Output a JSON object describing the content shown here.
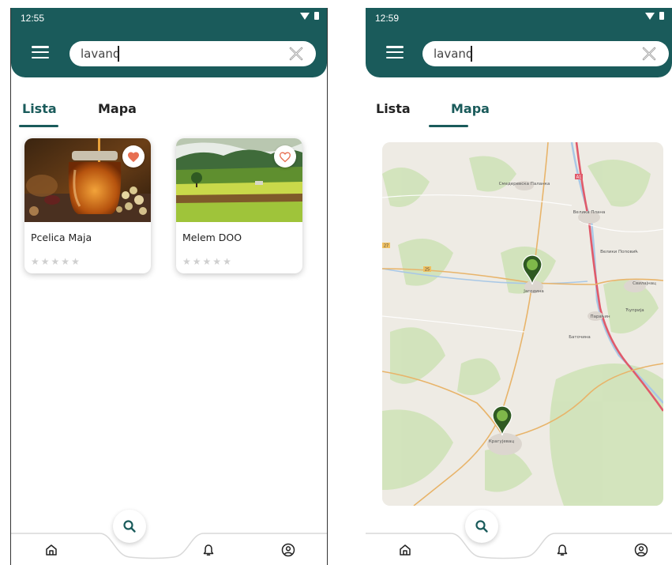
{
  "screens": [
    {
      "time": "12:55",
      "search": {
        "value": "lavand"
      },
      "tabs": [
        {
          "label": "Lista",
          "active": true
        },
        {
          "label": "Mapa",
          "active": false
        }
      ],
      "cards": [
        {
          "title": "Pcelica Maja",
          "favorite": true,
          "rating": 0
        },
        {
          "title": "Melem DOO",
          "favorite": false,
          "rating": 0
        }
      ]
    },
    {
      "time": "12:59",
      "search": {
        "value": "lavand"
      },
      "tabs": [
        {
          "label": "Lista",
          "active": false
        },
        {
          "label": "Mapa",
          "active": true
        }
      ],
      "map": {
        "labels": [
          "Свилајнац",
          "Велики Поповић",
          "Ћуприја",
          "Параћин",
          "Јагодина",
          "Крагујевац",
          "Баточина",
          "Смедеревска Паланка",
          "Велика Плана"
        ],
        "road_labels": [
          "A1",
          "27",
          "25"
        ],
        "markers": [
          {
            "place": "Јагодина"
          },
          {
            "place": "Крагујевац"
          }
        ]
      }
    }
  ],
  "bottom_nav": [
    "home-icon",
    "search-icon",
    "bell-icon",
    "profile-icon"
  ],
  "colors": {
    "primary": "#1a5b5b",
    "heart": "#e76f51",
    "star": "#cfcfcf",
    "tab_text": "#222222",
    "active_tab_text": "#1a5b5b"
  }
}
